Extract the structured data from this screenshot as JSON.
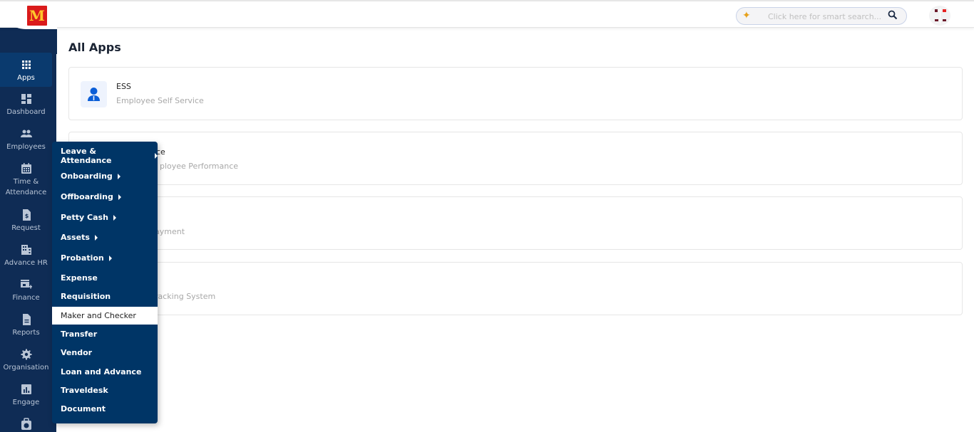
{
  "header": {
    "logo_text": "M",
    "search_placeholder": "Click here for smart search...",
    "colors": {
      "brand_red": "#da1b1b",
      "brand_yellow": "#ffc72c",
      "sidebar_bg": "#0f2c55",
      "menu_bg": "#003566"
    }
  },
  "sidebar": {
    "items": [
      {
        "label": "Apps",
        "icon": "grid-icon",
        "active": true
      },
      {
        "label": "Dashboard",
        "icon": "dashboard-icon"
      },
      {
        "label": "Employees",
        "icon": "people-icon"
      },
      {
        "label": "Time &\nAttendance",
        "icon": "calendar-icon"
      },
      {
        "label": "Request",
        "icon": "dollar-document-icon"
      },
      {
        "label": "Advance HR",
        "icon": "building-icon"
      },
      {
        "label": "Finance",
        "icon": "store-add-icon"
      },
      {
        "label": "Reports",
        "icon": "report-icon"
      },
      {
        "label": "Organisation",
        "icon": "gear-icon"
      },
      {
        "label": "Engage",
        "icon": "bar-chart-icon"
      },
      {
        "label": "",
        "icon": "timer-bag-icon"
      }
    ]
  },
  "main": {
    "title": "All Apps",
    "cards": [
      {
        "title": "ESS",
        "desc": "Employee Self Service"
      },
      {
        "title": "ce",
        "desc": "ployee Performance"
      },
      {
        "title": "",
        "desc": "ayment"
      },
      {
        "title": "",
        "desc": "racking System"
      }
    ]
  },
  "menu": {
    "items": [
      {
        "label": "Leave & Attendance",
        "submenu": true
      },
      {
        "label": "Onboarding",
        "submenu": true
      },
      {
        "label": "Offboarding",
        "submenu": true
      },
      {
        "label": "Petty Cash",
        "submenu": true
      },
      {
        "label": "Assets",
        "submenu": true
      },
      {
        "label": "Probation",
        "submenu": true
      },
      {
        "label": "Expense",
        "submenu": false
      },
      {
        "label": "Requisition",
        "submenu": false
      },
      {
        "label": "Maker and Checker",
        "submenu": false,
        "highlighted": true
      },
      {
        "label": "Transfer",
        "submenu": false
      },
      {
        "label": "Vendor",
        "submenu": false
      },
      {
        "label": "Loan and Advance",
        "submenu": false
      },
      {
        "label": "Traveldesk",
        "submenu": false
      },
      {
        "label": "Document",
        "submenu": false
      }
    ]
  }
}
